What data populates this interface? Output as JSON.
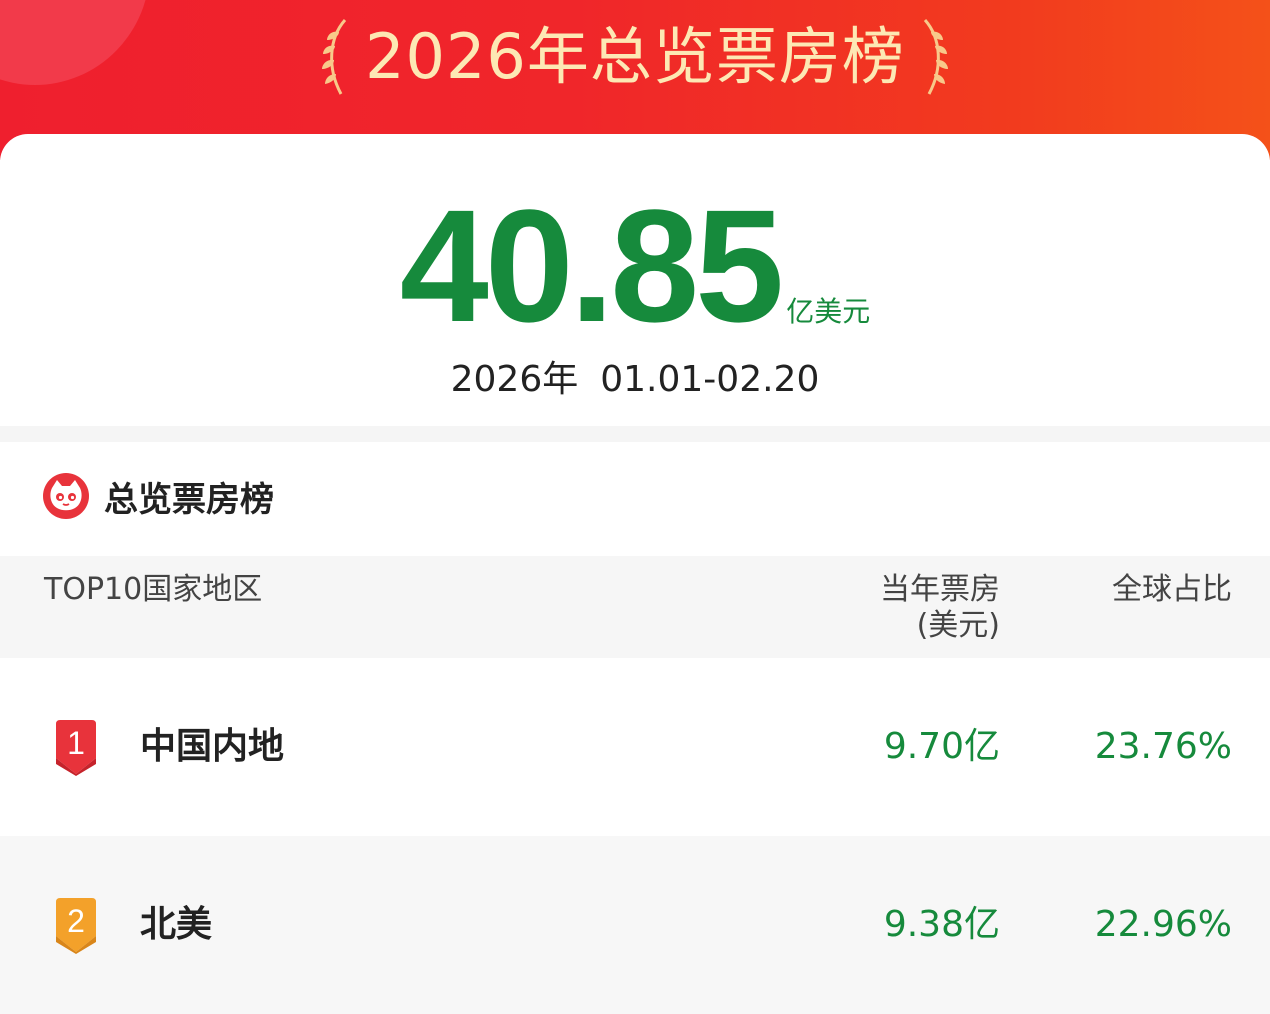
{
  "banner": {
    "title": "2026年总览票房榜"
  },
  "summary": {
    "total_value": "40.85",
    "total_unit": "亿美元",
    "year_label": "2026年",
    "date_range": "01.01-02.20"
  },
  "section": {
    "title": "总览票房榜",
    "logo_icon": "cat-logo-icon"
  },
  "table": {
    "headers": {
      "region": "TOP10国家地区",
      "box_office_line1": "当年票房",
      "box_office_line2": "(美元)",
      "global_share": "全球占比"
    },
    "rows": [
      {
        "rank": "1",
        "region": "中国内地",
        "box_office": "9.70亿",
        "share": "23.76%",
        "badge_color": "#e8333b"
      },
      {
        "rank": "2",
        "region": "北美",
        "box_office": "9.38亿",
        "share": "22.96%",
        "badge_color": "#f3a12a"
      }
    ]
  },
  "colors": {
    "banner_red": "#ef1f2e",
    "title_gold": "#fde8b4",
    "value_green": "#168a3c"
  }
}
